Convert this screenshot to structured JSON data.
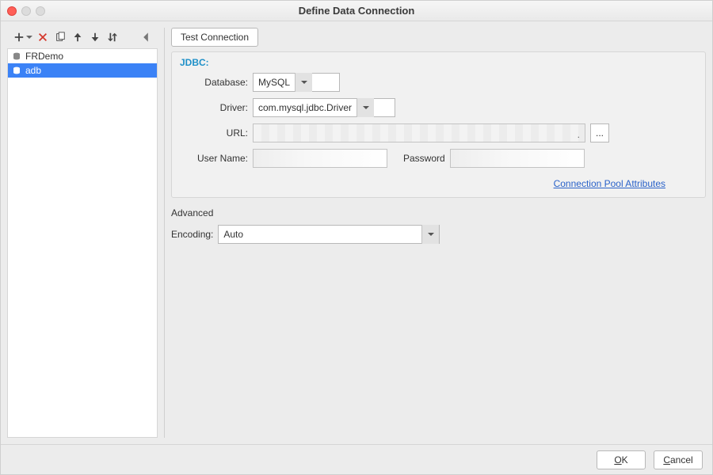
{
  "window": {
    "title": "Define Data Connection"
  },
  "sidebar": {
    "items": [
      {
        "label": "FRDemo",
        "selected": false
      },
      {
        "label": "adb",
        "selected": true
      }
    ]
  },
  "toolbar": {
    "add_icon": "plus-icon",
    "delete_icon": "x-icon",
    "copy_icon": "copy-icon",
    "up_icon": "arrow-up-icon",
    "down_icon": "arrow-down-icon",
    "sort_icon": "sort-icon",
    "menu_icon": "chevron-left-icon"
  },
  "main": {
    "test_button": "Test Connection",
    "jdbc_label": "JDBC:",
    "fields": {
      "database_label": "Database:",
      "database_value": "MySQL",
      "driver_label": "Driver:",
      "driver_value": "com.mysql.jdbc.Driver",
      "url_label": "URL:",
      "url_value": "",
      "url_more": "...",
      "username_label": "User Name:",
      "username_value": "",
      "password_label": "Password",
      "password_value": ""
    },
    "pool_link": "Connection Pool Attributes",
    "advanced_label": "Advanced",
    "encoding_label": "Encoding:",
    "encoding_value": "Auto"
  },
  "footer": {
    "ok": "OK",
    "ok_mnemonic": "O",
    "cancel": "Cancel",
    "cancel_mnemonic": "C"
  }
}
